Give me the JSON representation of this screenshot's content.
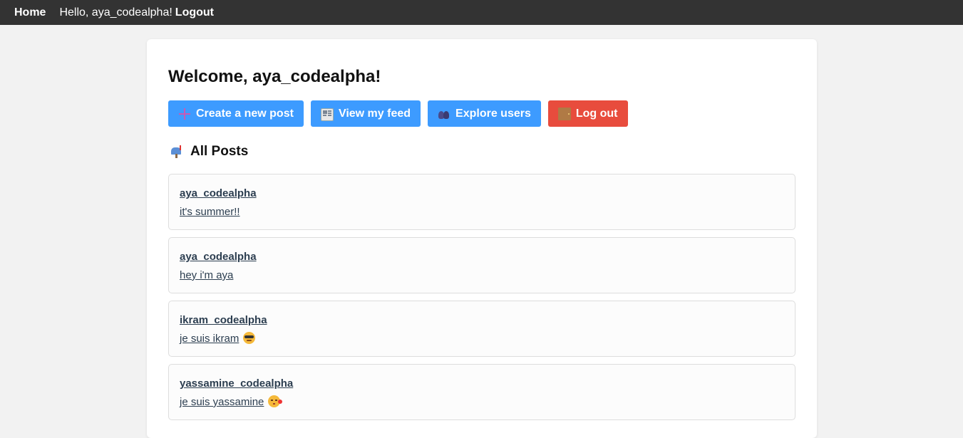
{
  "nav": {
    "home": "Home",
    "greeting": "Hello, aya_codealpha!",
    "logout": "Logout"
  },
  "welcome": "Welcome, aya_codealpha!",
  "actions": [
    {
      "label": "Create a new post",
      "icon": "plus-icon",
      "color": "#3d9bff"
    },
    {
      "label": "View my feed",
      "icon": "newspaper-icon",
      "color": "#3d9bff"
    },
    {
      "label": "Explore users",
      "icon": "users-icon",
      "color": "#3d9bff"
    },
    {
      "label": "Log out",
      "icon": "door-icon",
      "color": "#e84c3d"
    }
  ],
  "section_title": "All Posts",
  "section_icon": "mailbox-icon",
  "posts": [
    {
      "author": "aya_codealpha",
      "content": "it's summer!!"
    },
    {
      "author": "aya_codealpha",
      "content": "hey i'm aya"
    },
    {
      "author": "ikram_codealpha",
      "content": "je suis ikram",
      "emoji": "sunglasses-emoji"
    },
    {
      "author": "yassamine_codealpha",
      "content": "je suis yassamine",
      "emoji": "kiss-emoji"
    }
  ]
}
